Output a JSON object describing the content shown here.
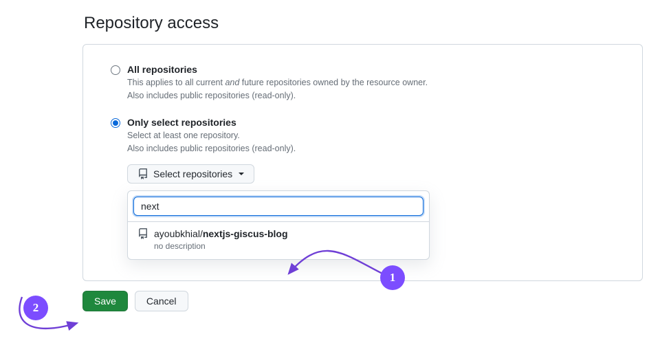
{
  "title": "Repository access",
  "options": {
    "all": {
      "label": "All repositories",
      "desc_before": "This applies to all current ",
      "desc_em": "and",
      "desc_after": " future repositories owned by the resource owner.",
      "desc_line2": "Also includes public repositories (read-only)."
    },
    "select": {
      "label": "Only select repositories",
      "desc_line1": "Select at least one repository.",
      "desc_line2": "Also includes public repositories (read-only)."
    }
  },
  "select_button": "Select repositories",
  "search_value": "next",
  "result": {
    "owner": "ayoubkhial/",
    "name": "nextjs-giscus-blog",
    "desc": "no description"
  },
  "buttons": {
    "save": "Save",
    "cancel": "Cancel"
  },
  "annotations": {
    "one": "1",
    "two": "2"
  }
}
